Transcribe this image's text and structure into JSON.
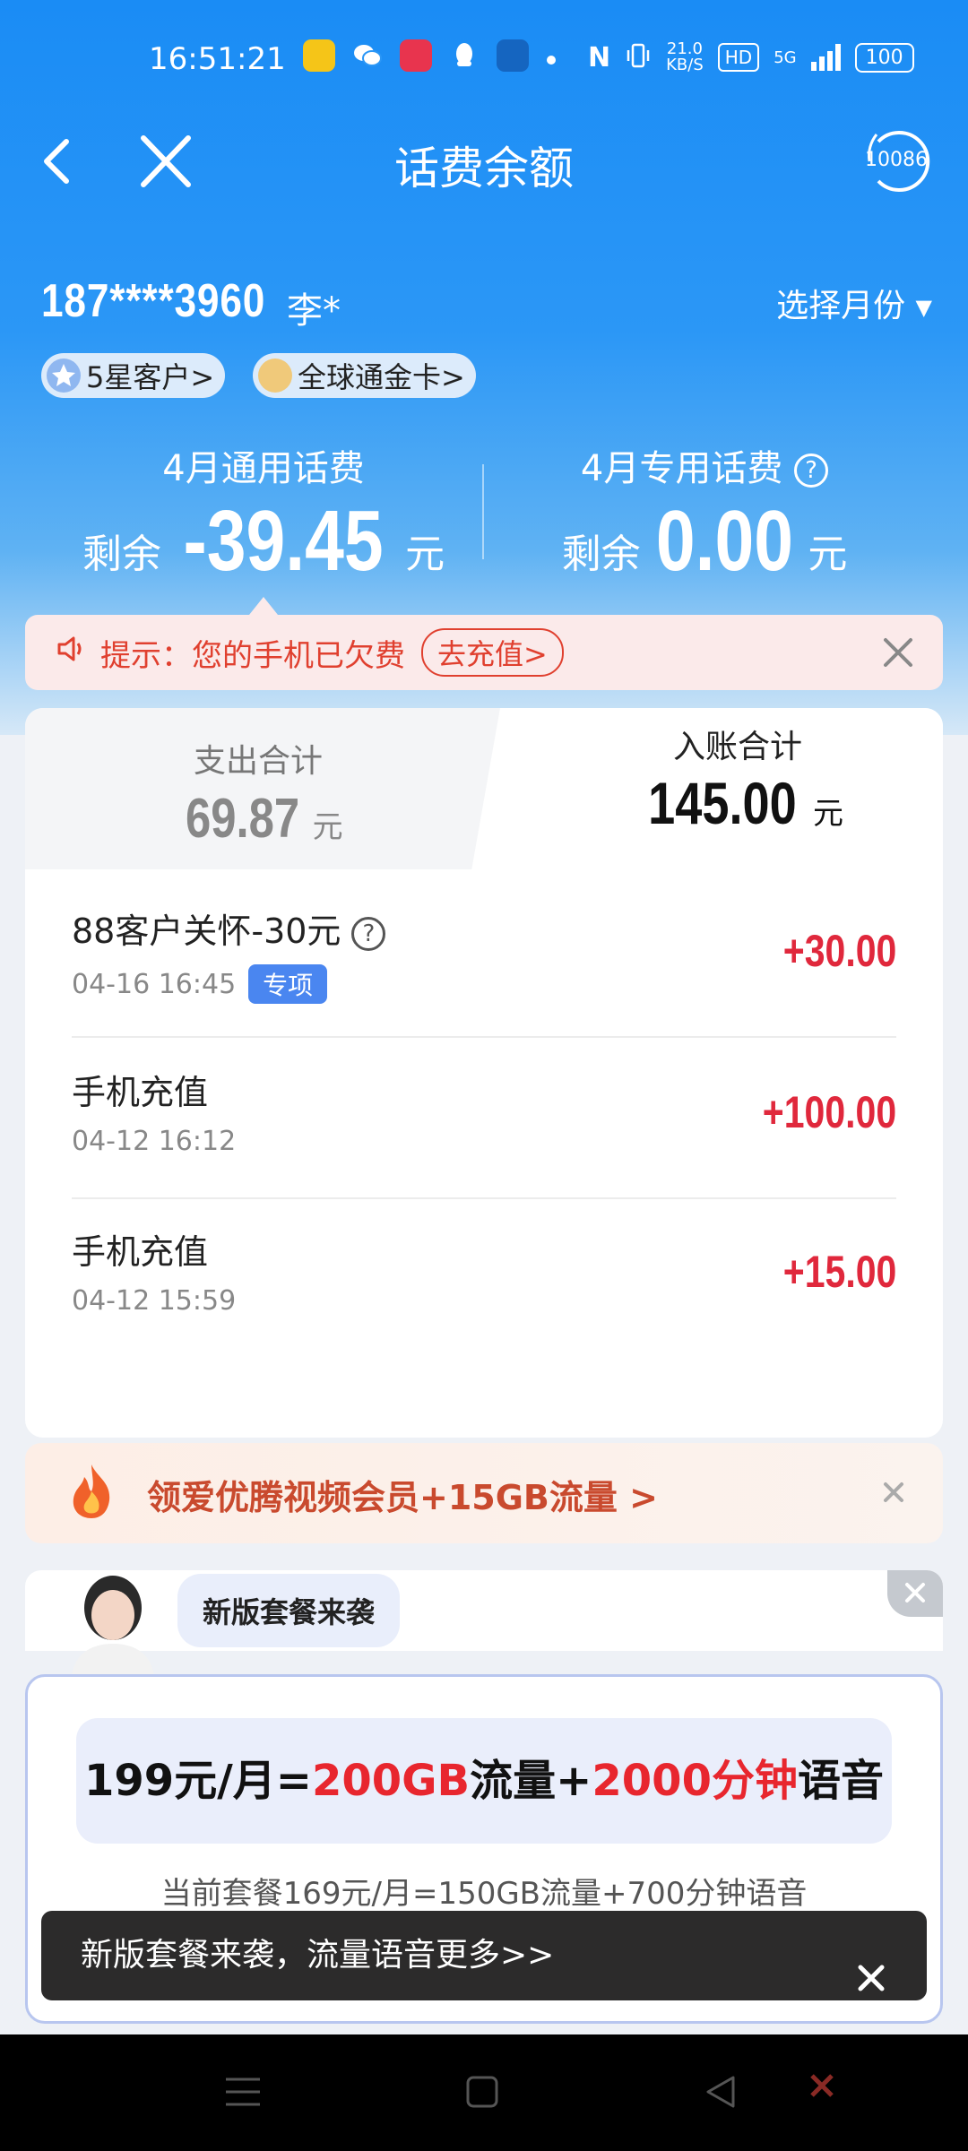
{
  "status_bar": {
    "time": "16:51:21",
    "net_speed": "21.0",
    "net_unit": "KB/S",
    "hd": "HD",
    "signal": "5G",
    "battery": "100"
  },
  "nav": {
    "title": "话费余额",
    "service_number": "10086"
  },
  "account": {
    "phone": "187****3960",
    "name": "李*",
    "month_picker": "选择月份",
    "tags": [
      {
        "label": "5星客户>"
      },
      {
        "label": "全球通金卡>"
      }
    ]
  },
  "balances": {
    "general": {
      "label": "4月通用话费",
      "prefix": "剩余",
      "value": "-39.45",
      "unit": "元"
    },
    "special": {
      "label": "4月专用话费",
      "prefix": "剩余",
      "value": "0.00",
      "unit": "元"
    }
  },
  "notice": {
    "text": "提示：您的手机已欠费",
    "button": "去充值>"
  },
  "summary": {
    "expense": {
      "label": "支出合计",
      "value": "69.87",
      "unit": "元"
    },
    "income": {
      "label": "入账合计",
      "value": "145.00",
      "unit": "元"
    }
  },
  "transactions": [
    {
      "title": "88客户关怀-30元",
      "time": "04-16 16:45",
      "badge": "专项",
      "amount": "+30.00"
    },
    {
      "title": "手机充值",
      "time": "04-12 16:12",
      "badge": "",
      "amount": "+100.00"
    },
    {
      "title": "手机充值",
      "time": "04-12 15:59",
      "badge": "",
      "amount": "+15.00"
    }
  ],
  "promo": {
    "text": "领爱优腾视频会员+15GB流量 >"
  },
  "package": {
    "bubble": "新版套餐来袭",
    "offer_price": "199元/月=",
    "offer_data": "200GB",
    "offer_data_suffix": "流量+",
    "offer_minutes": "2000分钟",
    "offer_minutes_suffix": "语音",
    "current": "当前套餐169元/月=150GB流量+700分钟语音"
  },
  "toast": {
    "text": "新版套餐来袭，流量语音更多>>"
  },
  "colors": {
    "primary_blue": "#1a8cf5",
    "amount_red": "#e0283c",
    "notice_red": "#e0402f",
    "badge_blue": "#4a86f0"
  }
}
